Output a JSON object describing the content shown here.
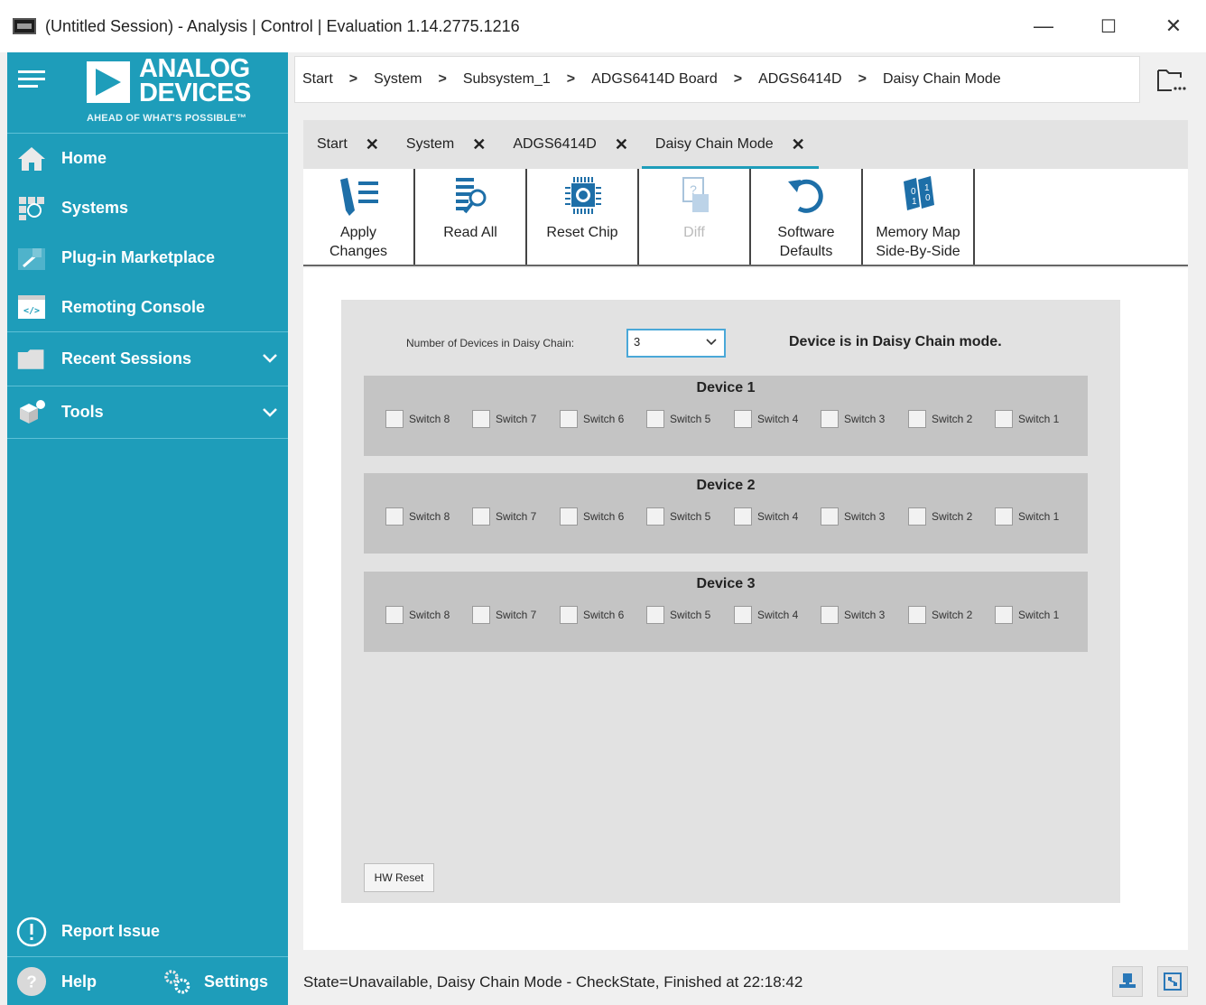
{
  "window": {
    "title": "(Untitled Session) - Analysis | Control | Evaluation 1.14.2775.1216",
    "minimize": "—",
    "maximize": "☐",
    "close": "✕"
  },
  "brand": {
    "line1": "ANALOG",
    "line2": "DEVICES",
    "tagline": "AHEAD OF WHAT'S POSSIBLE™"
  },
  "sidebar": {
    "items": [
      {
        "label": "Home",
        "icon": "home-icon"
      },
      {
        "label": "Systems",
        "icon": "systems-icon"
      },
      {
        "label": "Plug-in Marketplace",
        "icon": "marketplace-icon"
      },
      {
        "label": "Remoting Console",
        "icon": "console-icon"
      },
      {
        "label": "Recent Sessions",
        "icon": "folder-icon"
      },
      {
        "label": "Tools",
        "icon": "tools-icon"
      }
    ],
    "report_issue": "Report Issue",
    "help": "Help",
    "settings": "Settings"
  },
  "breadcrumb": [
    "Start",
    "System",
    "Subsystem_1",
    "ADGS6414D Board",
    "ADGS6414D",
    "Daisy Chain Mode"
  ],
  "tabs": [
    {
      "label": "Start",
      "active": false
    },
    {
      "label": "System",
      "active": false
    },
    {
      "label": "ADGS6414D",
      "active": false
    },
    {
      "label": "Daisy Chain Mode",
      "active": true
    }
  ],
  "toolbar": {
    "apply_l1": "Apply",
    "apply_l2": "Changes",
    "read_all": "Read All",
    "reset_chip": "Reset Chip",
    "diff": "Diff",
    "sw_l1": "Software",
    "sw_l2": "Defaults",
    "mm_l1": "Memory Map",
    "mm_l2": "Side-By-Side"
  },
  "daisy": {
    "num_label": "Number of Devices in Daisy Chain:",
    "num_value": "3",
    "status": "Device is in Daisy Chain mode.",
    "devices": [
      {
        "name": "Device 1",
        "switches": [
          "Switch 8",
          "Switch 7",
          "Switch 6",
          "Switch 5",
          "Switch 4",
          "Switch 3",
          "Switch 2",
          "Switch 1"
        ]
      },
      {
        "name": "Device 2",
        "switches": [
          "Switch 8",
          "Switch 7",
          "Switch 6",
          "Switch 5",
          "Switch 4",
          "Switch 3",
          "Switch 2",
          "Switch 1"
        ]
      },
      {
        "name": "Device 3",
        "switches": [
          "Switch 8",
          "Switch 7",
          "Switch 6",
          "Switch 5",
          "Switch 4",
          "Switch 3",
          "Switch 2",
          "Switch 1"
        ]
      }
    ],
    "hw_reset": "HW Reset"
  },
  "status_bar": {
    "text": "State=Unavailable, Daisy Chain Mode - CheckState, Finished at 22:18:42"
  },
  "colors": {
    "accent": "#1e9dba",
    "device_panel": "#c4c4c4"
  }
}
